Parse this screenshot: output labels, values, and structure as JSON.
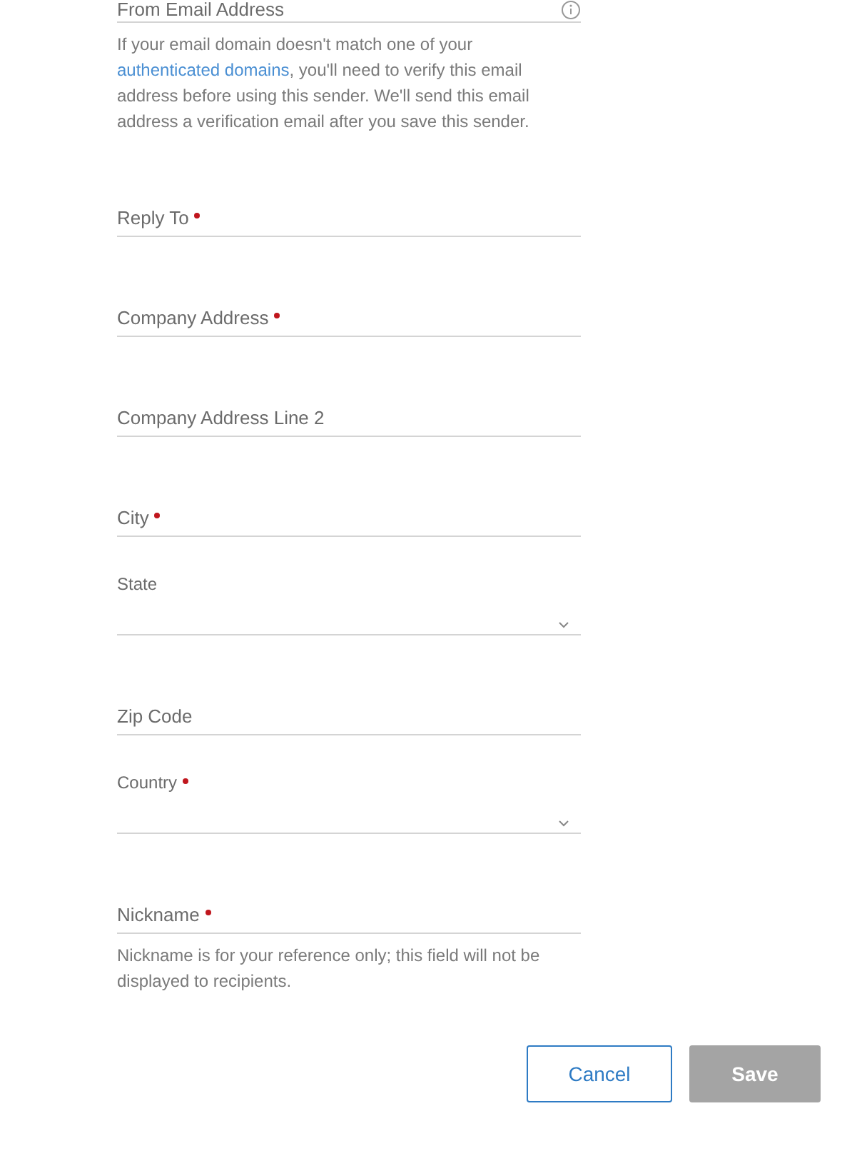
{
  "from_field": {
    "label": "From Email Address",
    "help_before": "If your email domain doesn't match one of your ",
    "help_link": "authenticated domains",
    "help_after": ", you'll need to verify this email address before using this sender. We'll send this email address a verification email after you save this sender."
  },
  "fields": [
    {
      "kind": "text",
      "label": "Reply To",
      "required": true
    },
    {
      "kind": "text",
      "label": "Company Address",
      "required": true
    },
    {
      "kind": "text",
      "label": "Company Address Line 2",
      "required": false
    },
    {
      "kind": "text",
      "label": "City",
      "required": true
    },
    {
      "kind": "select",
      "label": "State",
      "required": false
    },
    {
      "kind": "text",
      "label": "Zip Code",
      "required": false
    },
    {
      "kind": "select",
      "label": "Country",
      "required": true
    },
    {
      "kind": "text",
      "label": "Nickname",
      "required": true,
      "help": "Nickname is for your reference only; this field will not be displayed to recipients."
    }
  ],
  "buttons": [
    {
      "kind": "secondary",
      "label": "Cancel",
      "disabled": false
    },
    {
      "kind": "primary",
      "label": "Save",
      "disabled": true
    }
  ]
}
